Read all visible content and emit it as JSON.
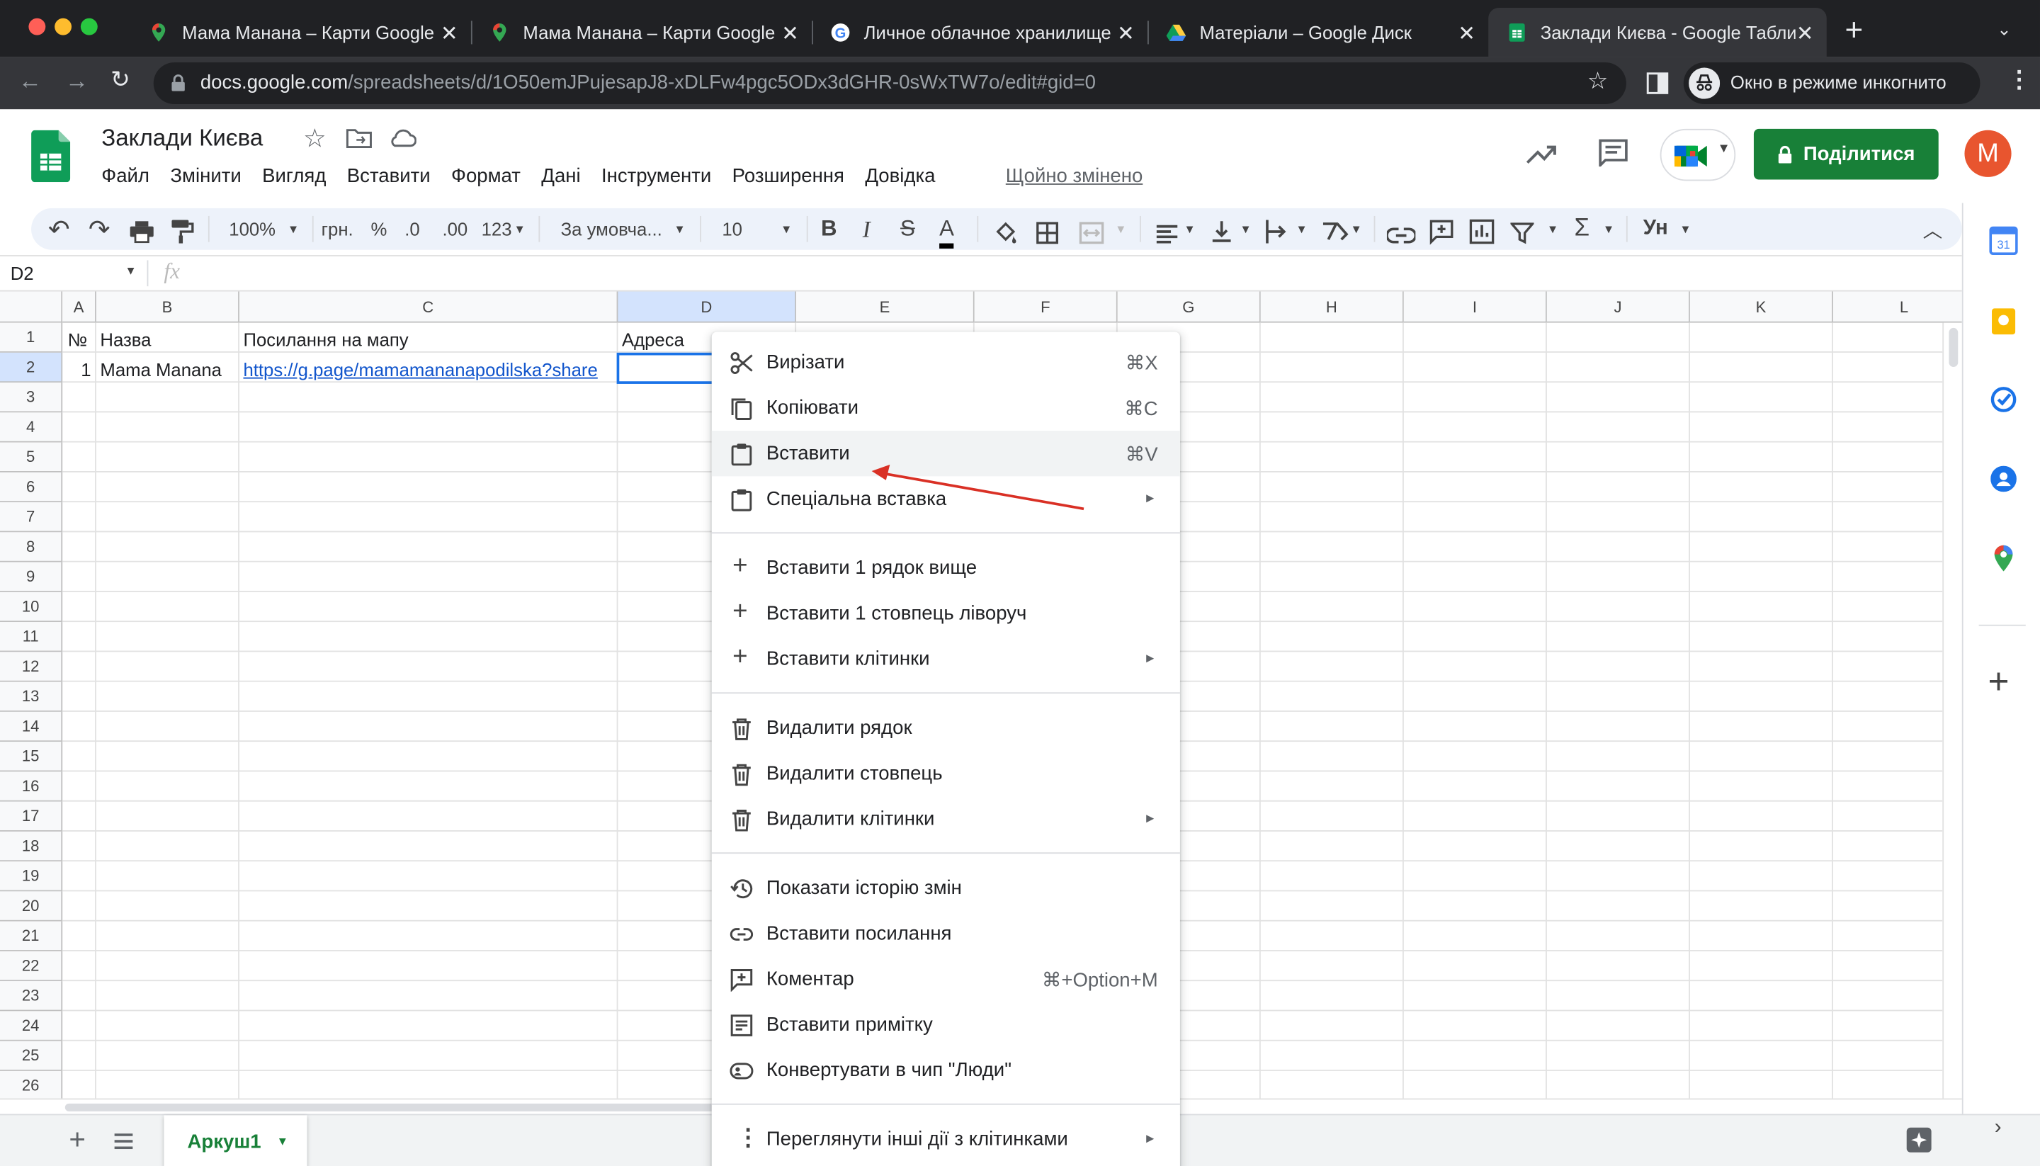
{
  "browser": {
    "tabs": [
      {
        "title": "Мама Манана – Карти Google",
        "icon": "maps-pin-icon"
      },
      {
        "title": "Мама Манана – Карти Google",
        "icon": "maps-pin-icon"
      },
      {
        "title": "Личное облачное хранилище",
        "icon": "google-g-icon"
      },
      {
        "title": "Матеріали – Google Диск",
        "icon": "google-drive-icon"
      },
      {
        "title": "Заклади Києва - Google Табли",
        "icon": "google-sheets-icon"
      }
    ],
    "url_host": "docs.google.com",
    "url_path": "/spreadsheets/d/1O50emJPujesapJ8-xDLFw4pgc5ODx3dGHR-0sWxTW7o/edit#gid=0",
    "incognito_label": "Окно в режиме инкогнито"
  },
  "doc": {
    "title": "Заклади Києва",
    "menus": [
      "Файл",
      "Змінити",
      "Вигляд",
      "Вставити",
      "Формат",
      "Дані",
      "Інструменти",
      "Розширення",
      "Довідка"
    ],
    "last_edit": "Щойно змінено",
    "share_label": "Поділитися",
    "avatar_letter": "M"
  },
  "toolbar": {
    "zoom": "100%",
    "currency": "грн.",
    "percent": "%",
    "dec_less": ".0",
    "dec_more": ".00",
    "format_more": "123",
    "font": "За умовча...",
    "font_size": "10"
  },
  "formula_bar": {
    "cell_ref": "D2",
    "fx": "fx",
    "value": ""
  },
  "grid": {
    "columns": [
      "A",
      "B",
      "C",
      "D",
      "E",
      "F",
      "G",
      "H",
      "I",
      "J",
      "K",
      "L"
    ],
    "rows": [
      "1",
      "2",
      "3",
      "4",
      "5",
      "6",
      "7",
      "8",
      "9",
      "10",
      "11",
      "12",
      "13",
      "14",
      "15",
      "16",
      "17",
      "18",
      "19",
      "20",
      "21",
      "22",
      "23",
      "24",
      "25",
      "26"
    ],
    "header_row": {
      "a": "№",
      "b": "Назва",
      "c": "Посилання на мапу",
      "d": "Адреса"
    },
    "data_row": {
      "a": "1",
      "b": "Mama Manana",
      "c": "https://g.page/mamamananapodilska?share",
      "d": ""
    }
  },
  "context_menu": {
    "items": [
      {
        "label": "Вирізати",
        "shortcut": "⌘X",
        "icon": "scissors-icon"
      },
      {
        "label": "Копіювати",
        "shortcut": "⌘C",
        "icon": "copy-icon"
      },
      {
        "label": "Вставити",
        "shortcut": "⌘V",
        "icon": "clipboard-icon"
      },
      {
        "label": "Спеціальна вставка",
        "icon": "clipboard-icon"
      },
      {
        "label": "Вставити 1 рядок вище",
        "icon": "plus-icon"
      },
      {
        "label": "Вставити 1 стовпець ліворуч",
        "icon": "plus-icon"
      },
      {
        "label": "Вставити клітинки",
        "icon": "plus-icon"
      },
      {
        "label": "Видалити рядок",
        "icon": "trash-icon"
      },
      {
        "label": "Видалити стовпець",
        "icon": "trash-icon"
      },
      {
        "label": "Видалити клітинки",
        "icon": "trash-icon"
      },
      {
        "label": "Показати історію змін",
        "icon": "history-icon"
      },
      {
        "label": "Вставити посилання",
        "icon": "link-icon"
      },
      {
        "label": "Коментар",
        "shortcut": "⌘+Option+M",
        "icon": "comment-add-icon"
      },
      {
        "label": "Вставити примітку",
        "icon": "note-icon"
      },
      {
        "label": "Конвертувати в чип \"Люди\"",
        "icon": "people-chip-icon"
      },
      {
        "label": "Переглянути інші дії з клітинками",
        "icon": "more-vert-icon"
      }
    ],
    "submenu_arrow": "►"
  },
  "sheets": {
    "active": "Аркуш1"
  },
  "colors": {
    "share_green": "#188038",
    "avatar": "#e8552f",
    "annotation_arrow": "#d93025",
    "link": "#1155cc",
    "selection": "#1a73e8"
  }
}
